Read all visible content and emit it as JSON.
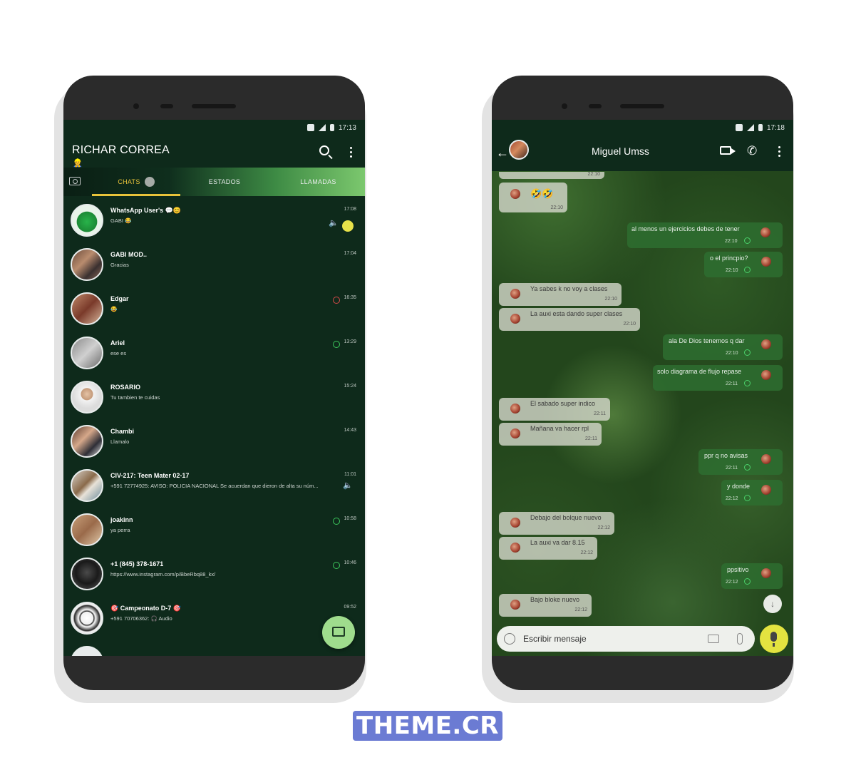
{
  "left_phone": {
    "status": {
      "time": "17:13"
    },
    "header": {
      "title": "RICHAR CORREA",
      "sub_emoji": "👷"
    },
    "tabs": [
      {
        "label": "CHATS"
      },
      {
        "label": "ESTADOS"
      },
      {
        "label": "LLAMADAS"
      }
    ],
    "chats": [
      {
        "name": "WhatsApp User's 💬😊",
        "message": "GABI 😂",
        "time": "17:08"
      },
      {
        "name": "GABI MOD..",
        "message": "Gracias",
        "time": "17:04"
      },
      {
        "name": "Edgar",
        "message": "😂",
        "time": "16:35"
      },
      {
        "name": "Ariel",
        "message": "ese es",
        "time": "13:29"
      },
      {
        "name": "ROSARIO",
        "message": "Tu tambien te cuidas",
        "time": "15:24"
      },
      {
        "name": "Chambi",
        "message": "Llamalo",
        "time": "14:43"
      },
      {
        "name": "CIV-217: Teen Mater 02-17",
        "message": "+591 72774925: AVISO:  POLICIA NACIONAL  Se acuerdan que dieron de alta su núm...",
        "time": "11:01"
      },
      {
        "name": "joakinn",
        "message": "ya perra",
        "time": "10:58"
      },
      {
        "name": "+1 (845) 378-1671",
        "message": "https://www.instagram.com/p/BbeRbq88_kx/",
        "time": "10:46"
      },
      {
        "name": "🎯 Campeonato D-7 🎯",
        "message": "+591 70706362: 🎧 Audio",
        "time": "09:52"
      }
    ]
  },
  "right_phone": {
    "status": {
      "time": "17:18"
    },
    "header": {
      "contact_name": "Miguel Umss"
    },
    "messages": [
      {
        "dir": "in",
        "text": "",
        "time": "22:10"
      },
      {
        "dir": "in",
        "text": "🤣🤣",
        "time": "22:10"
      },
      {
        "dir": "out",
        "text": "al menos un ejercicios debes de tener",
        "time": "22:10"
      },
      {
        "dir": "out",
        "text": "o el princpio?",
        "time": "22:10"
      },
      {
        "dir": "in",
        "text": "Ya sabes k no voy a clases",
        "time": "22:10"
      },
      {
        "dir": "in",
        "text": "La auxi esta dando super clases",
        "time": "22:10"
      },
      {
        "dir": "out",
        "text": "ala De Dios tenemos q dar",
        "time": "22:10"
      },
      {
        "dir": "out",
        "text": "solo diagrama de flujo repase",
        "time": "22:11"
      },
      {
        "dir": "in",
        "text": "El sabado super indico",
        "time": "22:11"
      },
      {
        "dir": "in",
        "text": "Mañana va hacer rpl",
        "time": "22:11"
      },
      {
        "dir": "out",
        "text": "ppr q no avisas",
        "time": "22:11"
      },
      {
        "dir": "out",
        "text": "y donde",
        "time": "22:12"
      },
      {
        "dir": "in",
        "text": "Debajo del bolque nuevo",
        "time": "22:12"
      },
      {
        "dir": "in",
        "text": "La auxi va dar 8.15",
        "time": "22:12"
      },
      {
        "dir": "out",
        "text": "ppsitivo",
        "time": "22:12"
      },
      {
        "dir": "in",
        "text": "Bajo bloke nuevo",
        "time": "22:12"
      }
    ],
    "composer": {
      "placeholder": "Escribir mensaje"
    }
  },
  "watermark": {
    "text": "THEME.CR"
  },
  "colors": {
    "header_bg": "#0e2a1b",
    "accent": "#e8c33a",
    "fab": "#9fdc8d",
    "mic": "#e3e340",
    "watermark": "#6b7bd3"
  }
}
